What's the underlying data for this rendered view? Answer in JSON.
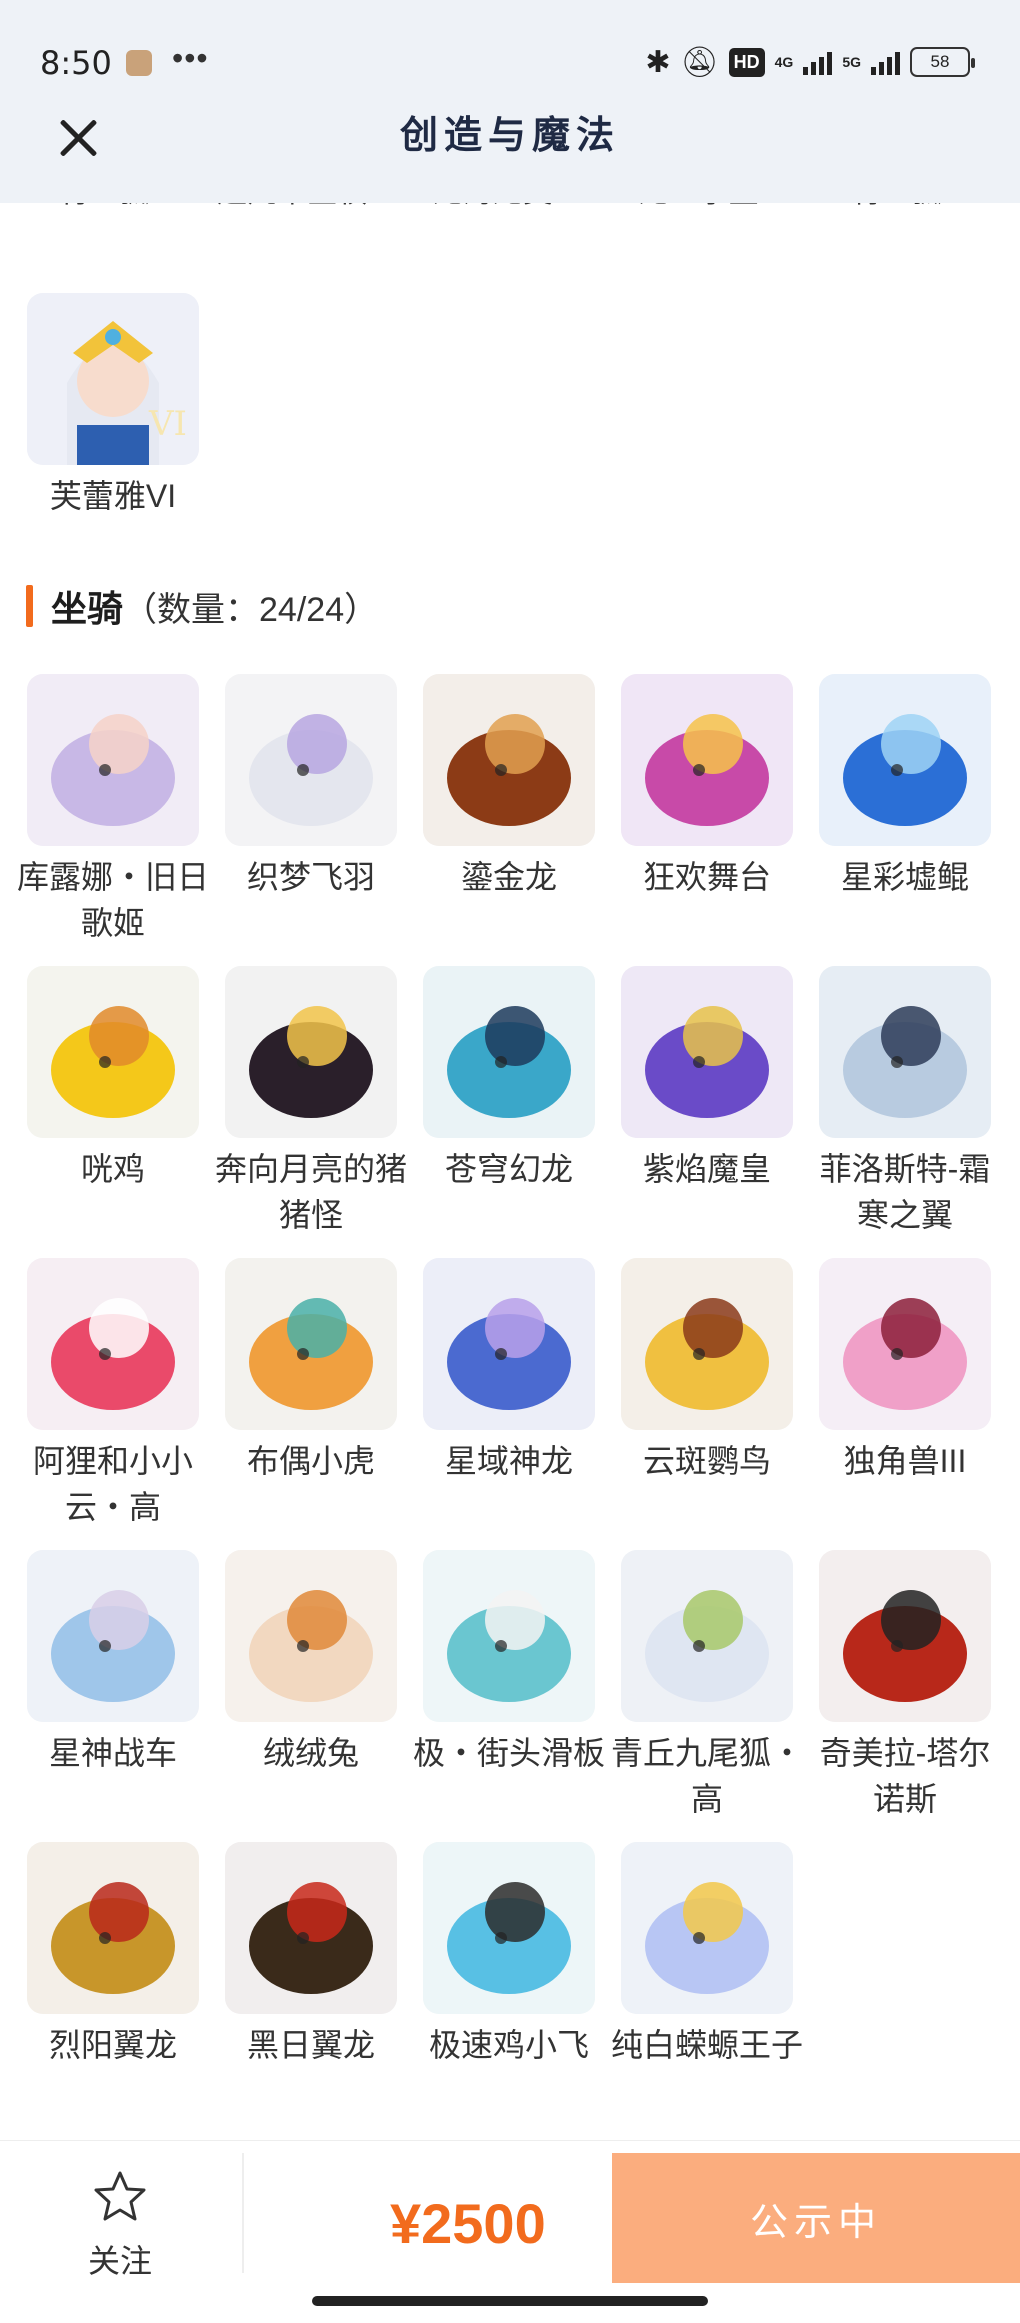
{
  "status_bar": {
    "time": "8:50",
    "dots": "•••",
    "hd": "HD",
    "sig1": "4G",
    "sig2": "5G",
    "battery": "58"
  },
  "header": {
    "title": "创造与魔法"
  },
  "cut_row": [
    "青丘狐II",
    "超凡帝星权 III",
    "龙海龙类IV",
    "龙血掌里II",
    "青丘狐V"
  ],
  "prev_items": [
    {
      "label": "芙蕾雅VI",
      "icon": "character-portrait"
    }
  ],
  "mounts_section": {
    "title": "坐骑",
    "count": "（数量：24/24）"
  },
  "mounts": [
    {
      "label": "库露娜・旧日歌姬",
      "icon": "idol-mount"
    },
    {
      "label": "织梦飞羽",
      "icon": "feather-mount"
    },
    {
      "label": "鎏金龙",
      "icon": "gold-dragon"
    },
    {
      "label": "狂欢舞台",
      "icon": "heart-stage"
    },
    {
      "label": "星彩墟鲲",
      "icon": "whale-mount"
    },
    {
      "label": "咣鸡",
      "icon": "chicken-mount"
    },
    {
      "label": "奔向月亮的猪猪怪",
      "icon": "pig-mount"
    },
    {
      "label": "苍穹幻龙",
      "icon": "sky-dragon"
    },
    {
      "label": "紫焰魔皇",
      "icon": "purple-phoenix"
    },
    {
      "label": "菲洛斯特-霜寒之翼",
      "icon": "frost-wing"
    },
    {
      "label": "阿狸和小小云・高",
      "icon": "fox-cloud"
    },
    {
      "label": "布偶小虎",
      "icon": "tiger-doll"
    },
    {
      "label": "星域神龙",
      "icon": "star-dragon"
    },
    {
      "label": "云斑鹦鸟",
      "icon": "parrot-mount"
    },
    {
      "label": "独角兽III",
      "icon": "unicorn-mount"
    },
    {
      "label": "星神战车",
      "icon": "star-chariot"
    },
    {
      "label": "绒绒兔",
      "icon": "fluffy-rabbit"
    },
    {
      "label": "极・街头滑板",
      "icon": "skateboard"
    },
    {
      "label": "青丘九尾狐・高",
      "icon": "ninetail-fox"
    },
    {
      "label": "奇美拉-塔尔诺斯",
      "icon": "chimera-mount"
    },
    {
      "label": "烈阳翼龙",
      "icon": "sun-wyvern"
    },
    {
      "label": "黑日翼龙",
      "icon": "black-wyvern"
    },
    {
      "label": "极速鸡小飞",
      "icon": "blue-chick"
    },
    {
      "label": "纯白蝾螈王子",
      "icon": "axolotl-prince"
    }
  ],
  "bottom": {
    "follow_label": "关注",
    "price": "¥2500",
    "status_button": "公示中"
  },
  "colors": {
    "accent": "#f26b1d",
    "button": "#fbad7e",
    "header_bg": "#eef2f7"
  }
}
